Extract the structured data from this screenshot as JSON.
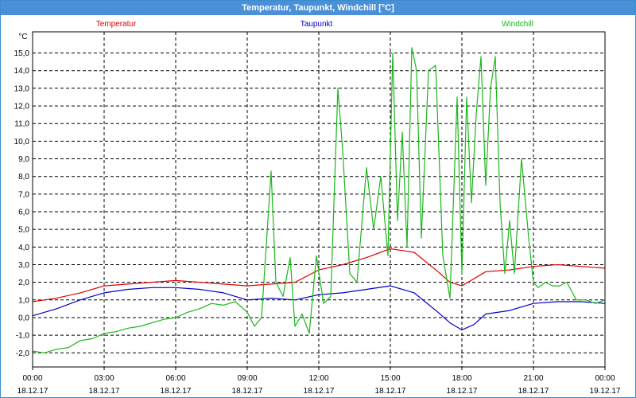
{
  "window": {
    "title": "Temperatur, Taupunkt, Windchill [°C]"
  },
  "colors": {
    "title_bar": "#4a90d8",
    "temperatur": "#e00000",
    "taupunkt": "#0000c8",
    "windchill": "#1ab81a",
    "grid": "#000000"
  },
  "chart_data": {
    "type": "line",
    "title": "Temperatur, Taupunkt, Windchill [°C]",
    "ylabel": "°C",
    "xlabel": "",
    "ylim": [
      -2.8,
      16.2
    ],
    "xlim": [
      0,
      24
    ],
    "grid": true,
    "legend_placement": "top",
    "y_ticks": [
      "-2,0",
      "-1,0",
      "0,0",
      "1,0",
      "2,0",
      "3,0",
      "4,0",
      "5,0",
      "6,0",
      "7,0",
      "8,0",
      "9,0",
      "10,0",
      "11,0",
      "12,0",
      "13,0",
      "14,0",
      "15,0"
    ],
    "x_ticks": [
      {
        "time": "00:00",
        "date": "18.12.17"
      },
      {
        "time": "03:00",
        "date": "18.12.17"
      },
      {
        "time": "06:00",
        "date": "18.12.17"
      },
      {
        "time": "09:00",
        "date": "18.12.17"
      },
      {
        "time": "12:00",
        "date": "18.12.17"
      },
      {
        "time": "15:00",
        "date": "18.12.17"
      },
      {
        "time": "18:00",
        "date": "18.12.17"
      },
      {
        "time": "21:00",
        "date": "18.12.17"
      },
      {
        "time": "00:00",
        "date": "19.12.17"
      }
    ],
    "series": [
      {
        "name": "Temperatur",
        "color": "#e00000",
        "x": [
          0,
          0.5,
          1,
          2,
          3,
          4,
          5,
          6,
          7,
          8,
          9,
          10,
          11,
          12,
          13,
          14,
          15,
          16,
          17,
          17.5,
          18,
          19,
          20,
          21,
          22,
          23,
          24
        ],
        "values": [
          0.9,
          1.0,
          1.1,
          1.4,
          1.8,
          1.9,
          2.0,
          2.1,
          2.0,
          1.9,
          1.8,
          1.9,
          2.0,
          2.7,
          3.0,
          3.4,
          3.9,
          3.7,
          2.6,
          2.0,
          1.8,
          2.6,
          2.7,
          2.9,
          3.0,
          2.9,
          2.8
        ]
      },
      {
        "name": "Taupunkt",
        "color": "#0000c8",
        "x": [
          0,
          0.5,
          1,
          2,
          3,
          4,
          5,
          6,
          7,
          8,
          9,
          10,
          11,
          12,
          13,
          14,
          15,
          16,
          17,
          17.5,
          18,
          18.5,
          19,
          20,
          21,
          22,
          23,
          24
        ],
        "values": [
          0.1,
          0.3,
          0.5,
          1.0,
          1.4,
          1.6,
          1.7,
          1.7,
          1.6,
          1.4,
          1.0,
          1.1,
          1.0,
          1.3,
          1.4,
          1.6,
          1.8,
          1.4,
          0.3,
          -0.3,
          -0.7,
          -0.4,
          0.2,
          0.4,
          0.8,
          0.9,
          0.9,
          0.8
        ]
      },
      {
        "name": "Windchill",
        "color": "#1ab81a",
        "x": [
          0,
          0.5,
          1,
          1.5,
          2,
          2.5,
          3,
          3.5,
          4,
          4.5,
          5,
          5.5,
          6,
          6.5,
          7,
          7.5,
          8,
          8.5,
          9,
          9.3,
          9.6,
          10,
          10.2,
          10.5,
          10.8,
          11,
          11.3,
          11.6,
          11.9,
          12.2,
          12.5,
          12.8,
          13,
          13.3,
          13.6,
          14,
          14.3,
          14.6,
          14.9,
          15.1,
          15.3,
          15.5,
          15.7,
          15.9,
          16.1,
          16.3,
          16.6,
          16.9,
          17.2,
          17.5,
          17.8,
          18.0,
          18.2,
          18.4,
          18.6,
          18.8,
          19.0,
          19.2,
          19.4,
          19.6,
          19.8,
          20.0,
          20.2,
          20.5,
          20.8,
          21.0,
          21.2,
          21.5,
          21.8,
          22.1,
          22.4,
          22.8,
          23.2,
          23.6,
          24
        ],
        "values": [
          -1.9,
          -2.0,
          -1.8,
          -1.7,
          -1.3,
          -1.2,
          -0.9,
          -0.8,
          -0.6,
          -0.5,
          -0.3,
          -0.1,
          0.0,
          0.3,
          0.5,
          0.8,
          0.7,
          0.9,
          0.3,
          -0.5,
          0.0,
          8.3,
          2.0,
          1.2,
          3.4,
          -0.5,
          0.2,
          -0.9,
          3.5,
          0.8,
          1.2,
          13.0,
          9.5,
          2.5,
          2.0,
          8.5,
          5.0,
          8.0,
          3.5,
          15.0,
          5.5,
          10.5,
          4.0,
          15.3,
          14.0,
          4.5,
          14.0,
          14.3,
          3.5,
          1.1,
          12.5,
          2.5,
          12.5,
          6.5,
          11.5,
          14.8,
          7.5,
          13.0,
          14.8,
          6.5,
          2.5,
          5.5,
          2.5,
          9.0,
          4.5,
          2.0,
          1.7,
          2.0,
          1.8,
          1.8,
          2.0,
          1.0,
          1.0,
          0.8,
          1.0
        ]
      }
    ]
  }
}
